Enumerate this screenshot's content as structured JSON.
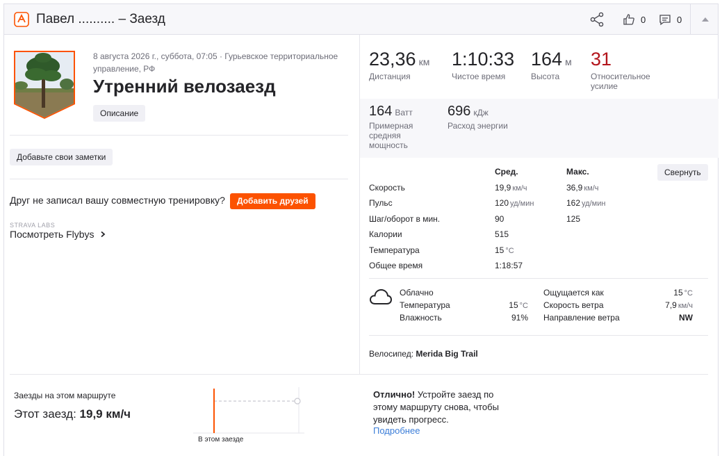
{
  "header": {
    "title": "Павел .......... – Заезд",
    "kudos_count": "0",
    "comments_count": "0"
  },
  "activity": {
    "meta": "8 августа 2026 г., суббота, 07:05 · Гурьевское территориальное управление, РФ",
    "title": "Утренний велозаезд",
    "description_button": "Описание",
    "notes_button": "Добавьте свои заметки",
    "friend_text": "Друг не записал вашу совместную тренировку?",
    "friend_button": "Добавить друзей",
    "labs_label": "STRAVA LABS",
    "flybys_prefix": "Посмотреть ",
    "flybys_link": "Flybys"
  },
  "stats": {
    "distance": {
      "value": "23,36",
      "unit": "км",
      "label": "Дистанция"
    },
    "moving_time": {
      "value": "1:10:33",
      "label": "Чистое время"
    },
    "elevation": {
      "value": "164",
      "unit": "м",
      "label": "Высота"
    },
    "relative_effort": {
      "value": "31",
      "label": "Относительное усилие"
    },
    "power": {
      "value": "164",
      "unit": "Ватт",
      "label": "Примерная средняя мощность"
    },
    "energy": {
      "value": "696",
      "unit": "кДж",
      "label": "Расход энергии"
    }
  },
  "details": {
    "avg_header": "Сред.",
    "max_header": "Макс.",
    "collapse_button": "Свернуть",
    "rows": [
      {
        "label": "Скорость",
        "avg": "19,9",
        "avg_unit": "км/ч",
        "max": "36,9",
        "max_unit": "км/ч"
      },
      {
        "label": "Пульс",
        "avg": "120",
        "avg_unit": "уд/мин",
        "max": "162",
        "max_unit": "уд/мин"
      },
      {
        "label": "Шаг/оборот в мин.",
        "avg": "90",
        "avg_unit": "",
        "max": "125",
        "max_unit": ""
      },
      {
        "label": "Калории",
        "avg": "515",
        "avg_unit": "",
        "max": "",
        "max_unit": ""
      },
      {
        "label": "Температура",
        "avg": "15",
        "avg_unit": "°C",
        "max": "",
        "max_unit": ""
      },
      {
        "label": "Общее время",
        "avg": "1:18:57",
        "avg_unit": "",
        "max": "",
        "max_unit": ""
      }
    ]
  },
  "weather": {
    "condition": "Облачно",
    "temp_label": "Температура",
    "temp_value": "15",
    "temp_unit": "°C",
    "humidity_label": "Влажность",
    "humidity_value": "91%",
    "feels_label": "Ощущается как",
    "feels_value": "15",
    "feels_unit": "°C",
    "wind_speed_label": "Скорость ветра",
    "wind_speed_value": "7,9",
    "wind_speed_unit": "км/ч",
    "wind_dir_label": "Направление ветра",
    "wind_dir_value": "NW"
  },
  "bike": {
    "label": "Велосипед:",
    "name": "Merida Big Trail"
  },
  "route": {
    "heading": "Заезды на этом маршруте",
    "this_ride_label": "Этот заезд:",
    "this_ride_value": "19,9 км/ч",
    "chart_label": "В этом заезде",
    "great_bold": "Отлично!",
    "great_text": " Устройте заезд по этому маршруту снова, чтобы увидеть прогресс.",
    "more_link": "Подробнее"
  },
  "colors": {
    "accent": "#fc5200",
    "effort": "#b3151c",
    "link": "#3b7dd8"
  }
}
